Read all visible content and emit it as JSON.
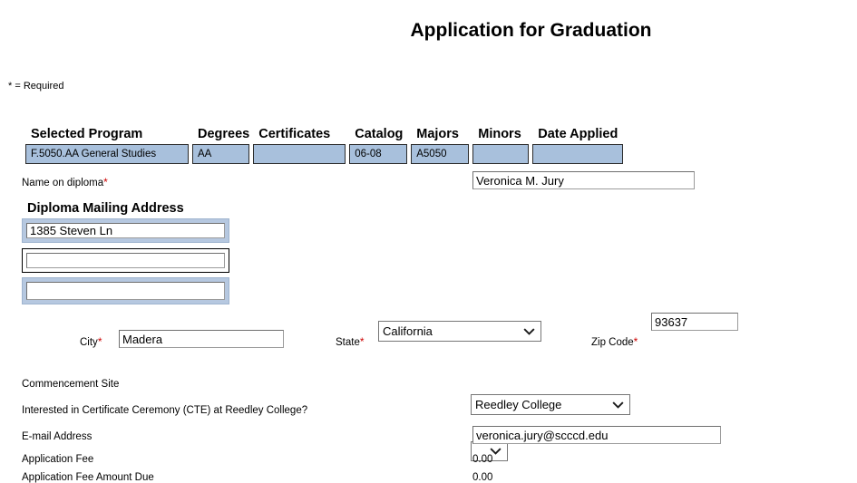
{
  "page": {
    "title": "Application for Graduation",
    "required_note": "* = Required"
  },
  "program_table": {
    "headers": [
      "Selected Program",
      "Degrees",
      "Certificates",
      "Catalog",
      "Majors",
      "Minors",
      "Date Applied"
    ],
    "row": {
      "selected_program": "F.5050.AA General Studies",
      "degrees": "AA",
      "certificates": "",
      "catalog": "06-08",
      "majors": "A5050",
      "minors": "",
      "date_applied": ""
    },
    "cell_bg": "#a8c0dc"
  },
  "diploma": {
    "name_label": "Name on diploma",
    "name_value": "Veronica M. Jury",
    "address_heading": "Diploma Mailing Address",
    "address_line1": "1385 Steven Ln",
    "address_line2": "",
    "address_line3": ""
  },
  "location": {
    "city_label": "City",
    "city_value": "Madera",
    "state_label": "State",
    "state_value": "California",
    "zip_label": "Zip Code",
    "zip_value": "93637"
  },
  "ceremony": {
    "commencement_label": "Commencement Site",
    "commencement_value": "Reedley College",
    "cte_label": "Interested in Certificate Ceremony (CTE) at Reedley College?",
    "cte_value": ""
  },
  "contact": {
    "email_label": "E-mail Address",
    "email_value": "veronica.jury@scccd.edu"
  },
  "fees": {
    "app_fee_label": "Application Fee",
    "app_fee_value": "0.00",
    "amount_due_label": "Application Fee Amount Due",
    "amount_due_value": "0.00"
  },
  "icons": {
    "chevron_down": "chevron-down-icon"
  },
  "colors": {
    "required_star": "#cc0000",
    "table_cell": "#a8c0dc",
    "address_frame": "#b6c8e0"
  }
}
